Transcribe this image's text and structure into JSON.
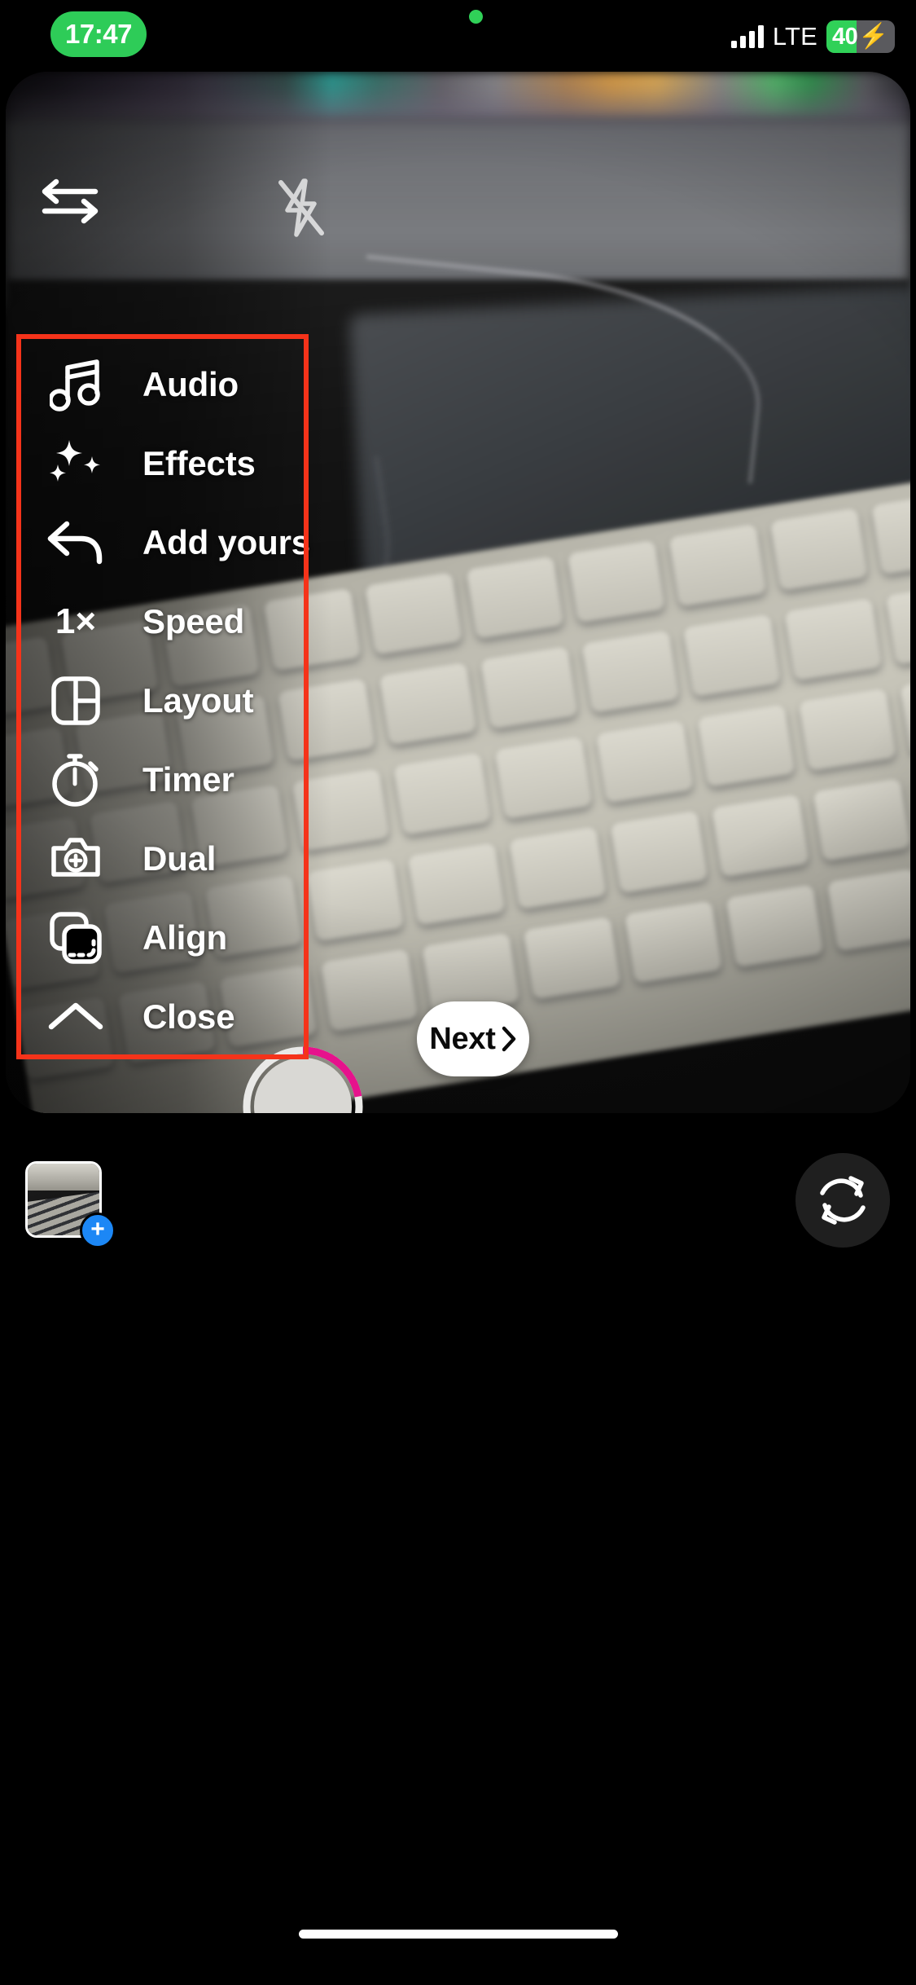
{
  "status_bar": {
    "time": "17:47",
    "time_pill_color": "#2ecc58",
    "recording_dot_color": "#30d158",
    "network": "LTE",
    "battery_level": "40",
    "battery_charging_glyph": "⚡",
    "battery_fill_color": "#30d158",
    "signal_bars": 4
  },
  "camera": {
    "flip_icon": "flip-camera-icon",
    "flash_icon": "flash-off-icon",
    "flash_state": "off"
  },
  "menu": {
    "items": [
      {
        "label": "Audio",
        "icon": "music-note-icon"
      },
      {
        "label": "Effects",
        "icon": "sparkles-icon"
      },
      {
        "label": "Add yours",
        "icon": "reply-arrow-icon"
      },
      {
        "label": "Speed",
        "icon": "speed-1x-icon",
        "icon_text": "1×"
      },
      {
        "label": "Layout",
        "icon": "layout-grid-icon"
      },
      {
        "label": "Timer",
        "icon": "stopwatch-icon"
      },
      {
        "label": "Dual",
        "icon": "dual-camera-icon"
      },
      {
        "label": "Align",
        "icon": "align-frames-icon"
      },
      {
        "label": "Close",
        "icon": "chevron-up-icon"
      }
    ]
  },
  "annotation": {
    "color": "#f5331a",
    "shape": "rectangle"
  },
  "capture": {
    "shutter_icon": "shutter-ring",
    "progress_arc_color": "#e6128c",
    "progress_percent": 22,
    "next_label": "Next",
    "next_chevron": "chevron-right-icon"
  },
  "bottom_bar": {
    "gallery_icon": "gallery-thumbnail",
    "gallery_badge": "+",
    "gallery_badge_color": "#1c87f5",
    "rotate_icon": "rotate-refresh-icon",
    "home_indicator": "home-indicator"
  }
}
